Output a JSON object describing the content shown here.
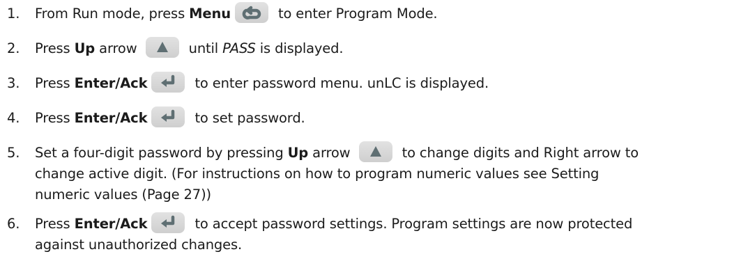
{
  "steps": [
    {
      "number": "1.",
      "parts": {
        "pre": "From Run mode, press ",
        "bold": "Menu",
        "post": " to enter Program Mode.",
        "key_icon": "menu-key-icon"
      }
    },
    {
      "number": "2.",
      "parts": {
        "pre": "Press ",
        "bold": "Up",
        "mid": " arrow ",
        "post1": " until ",
        "italic": "PASS",
        "post2": " is displayed.",
        "key_icon": "up-arrow-key-icon"
      }
    },
    {
      "number": "3.",
      "parts": {
        "pre": "Press ",
        "bold": "Enter/Ack",
        "post": " to enter password menu. unLC is displayed.",
        "key_icon": "enter-ack-key-icon"
      }
    },
    {
      "number": "4.",
      "parts": {
        "pre": "Press ",
        "bold": "Enter/Ack",
        "post": " to set password.",
        "key_icon": "enter-ack-key-icon"
      }
    },
    {
      "number": "5.",
      "parts": {
        "pre": "Set a four-digit password by pressing ",
        "bold": "Up",
        "mid": " arrow ",
        "post": " to change digits and Right arrow to",
        "line2": "change active digit. (For instructions on how to program numeric values see Setting",
        "line3": "numeric values (Page 27))",
        "key_icon": "up-arrow-key-icon"
      }
    },
    {
      "number": "6.",
      "parts": {
        "pre": "Press ",
        "bold": "Enter/Ack",
        "post": " to accept password settings. Program settings are now protected",
        "line2": "against unauthorized changes.",
        "key_icon": "enter-ack-key-icon"
      }
    }
  ],
  "colors": {
    "text": "#1b1b1b",
    "key_background": "#d9d9d9",
    "key_glyph": "#5f6f73"
  }
}
